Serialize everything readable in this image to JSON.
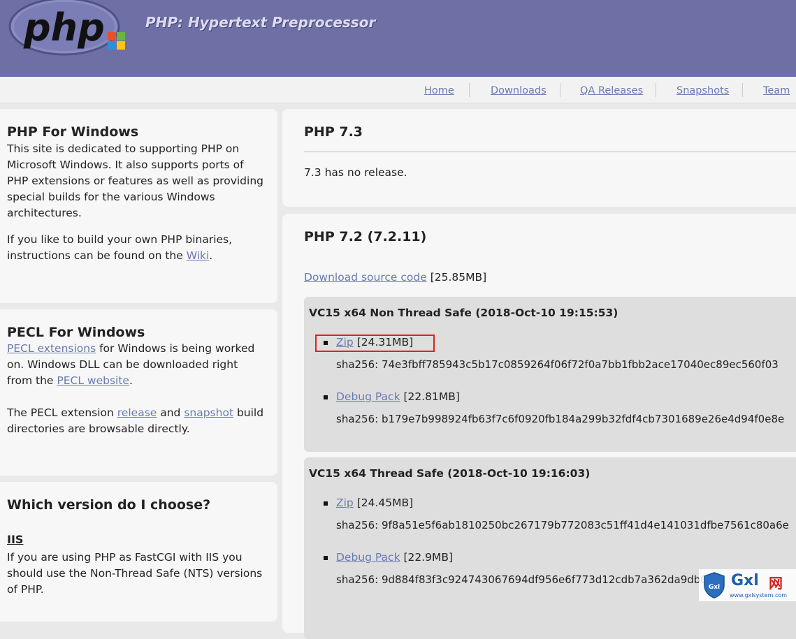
{
  "header": {
    "logo_text": "php",
    "site_title": "PHP: Hypertext Preprocessor"
  },
  "nav": {
    "items": [
      "Home",
      "Downloads",
      "QA Releases",
      "Snapshots",
      "Team"
    ]
  },
  "sidebar": {
    "php_windows": {
      "title": "PHP For Windows",
      "p1": "This site is dedicated to supporting PHP on Microsoft Windows. It also supports ports of PHP extensions or features as well as providing special builds for the various Windows architectures.",
      "p2_before": "If you like to build your own PHP binaries, instructions can be found on the ",
      "p2_link": "Wiki",
      "p2_after": "."
    },
    "pecl": {
      "title": "PECL For Windows",
      "p1_link": "PECL extensions",
      "p1_mid": " for Windows is being worked on. Windows DLL can be downloaded right from the ",
      "p1_link2": "PECL website",
      "p1_after": ".",
      "p2_before": "The PECL extension ",
      "p2_link1": "release",
      "p2_mid": " and ",
      "p2_link2": "snapshot",
      "p2_after": " build directories are browsable directly."
    },
    "choose": {
      "title": "Which version do I choose?",
      "subtitle": "IIS",
      "p1": "If you are using PHP as FastCGI with IIS you should use the Non-Thread Safe (NTS) versions of PHP."
    }
  },
  "php73": {
    "title": "PHP 7.3",
    "note": "7.3 has no release."
  },
  "php72": {
    "title": "PHP 7.2 (7.2.11)",
    "source_link": "Download source code",
    "source_size": "[25.85MB]",
    "builds": [
      {
        "title": "VC15 x64 Non Thread Safe (2018-Oct-10 19:15:53)",
        "zip_label": "Zip",
        "zip_size": "[24.31MB]",
        "zip_sha": "sha256: 74e3fbff785943c5b17c0859264f06f72f0a7bb1fbb2ace17040ec89ec560f03",
        "debug_label": "Debug Pack",
        "debug_size": "[22.81MB]",
        "debug_sha": "sha256: b179e7b998924fb63f7c6f0920fb184a299b32fdf4cb7301689e26e4d94f0e8e"
      },
      {
        "title": "VC15 x64 Thread Safe (2018-Oct-10 19:16:03)",
        "zip_label": "Zip",
        "zip_size": "[24.45MB]",
        "zip_sha": "sha256: 9f8a51e5f6ab1810250bc267179b772083c51ff41d4e141031dfbe7561c80a6e",
        "debug_label": "Debug Pack",
        "debug_size": "[22.9MB]",
        "debug_sha": "sha256: 9d884f83f3c924743067694df956e6f773d12cdb7a362da9db0c5"
      }
    ]
  },
  "watermark": {
    "brand": "Gxl",
    "url": "www.gxlsystem.com"
  },
  "colors": {
    "header_bg": "#6d6fa5",
    "link": "#6a7ab0",
    "highlight_box": "#e02020"
  }
}
